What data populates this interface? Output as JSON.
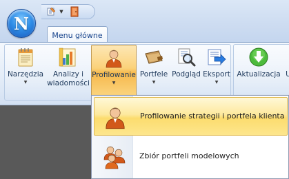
{
  "app": {
    "orb_letter": "N",
    "orb_icon": "app-orb-icon"
  },
  "quick_access": {
    "items": [
      {
        "icon": "customize-icon",
        "glyph": "🖉"
      },
      {
        "icon": "dropdown-arrow-icon",
        "glyph": "▼"
      },
      {
        "icon": "exit-door-icon",
        "glyph": "▮"
      }
    ]
  },
  "tabs": [
    {
      "label": "Menu główne",
      "active": true
    }
  ],
  "ribbon": {
    "buttons": [
      {
        "label": "Narzędzia",
        "has_arrow": true,
        "icon": "notepad-icon"
      },
      {
        "label": "Analizy i\nwiadomości",
        "has_arrow": false,
        "icon": "bar-chart-icon"
      },
      {
        "label": "Profilowanie",
        "has_arrow": true,
        "icon": "person-icon",
        "active": true
      },
      {
        "label": "Portfele",
        "has_arrow": true,
        "icon": "wallet-icon"
      },
      {
        "label": "Podgląd",
        "has_arrow": false,
        "icon": "magnifier-icon"
      },
      {
        "label": "Eksport",
        "has_arrow": true,
        "icon": "export-arrow-icon"
      },
      {
        "label": "Aktualizacja",
        "has_arrow": false,
        "icon": "download-arrow-icon"
      },
      {
        "label": "U",
        "has_arrow": false,
        "icon": ""
      }
    ],
    "dropdown_arrow_glyph": "▼"
  },
  "dropdown": {
    "items": [
      {
        "label": "Profilowanie strategii i portfela klienta",
        "icon": "person-icon",
        "highlighted": true
      },
      {
        "label": "Zbiór portfeli modelowych",
        "icon": "people-group-icon",
        "highlighted": false
      }
    ]
  },
  "colors": {
    "accent_orange": "#fbd27a",
    "highlight_yellow": "#fde99e",
    "ribbon_blue": "#d4e1f3",
    "text_blue": "#1e395b",
    "workspace_gray": "#595959"
  }
}
